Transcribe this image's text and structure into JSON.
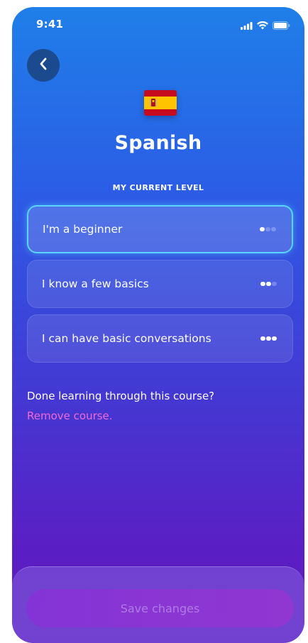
{
  "status_bar": {
    "time": "9:41",
    "icons": [
      "cellular-signal-icon",
      "wifi-icon",
      "battery-icon"
    ]
  },
  "nav": {
    "back_icon": "chevron-left-icon"
  },
  "course": {
    "flag_icon": "spain-flag-icon",
    "language": "Spanish"
  },
  "level_section": {
    "heading": "MY CURRENT LEVEL",
    "options": [
      {
        "label": "I'm a beginner",
        "level": 1,
        "selected": true
      },
      {
        "label": "I know a few basics",
        "level": 2,
        "selected": false
      },
      {
        "label": "I can have basic conversations",
        "level": 3,
        "selected": false
      }
    ]
  },
  "footer_note": {
    "question": "Done learning through this course?",
    "remove_link": "Remove course."
  },
  "actions": {
    "save_label": "Save changes",
    "save_enabled": false
  },
  "colors": {
    "selected_border": "#58d6ff",
    "remove_link": "#f06ad6",
    "save_button": "#9b34d2"
  }
}
